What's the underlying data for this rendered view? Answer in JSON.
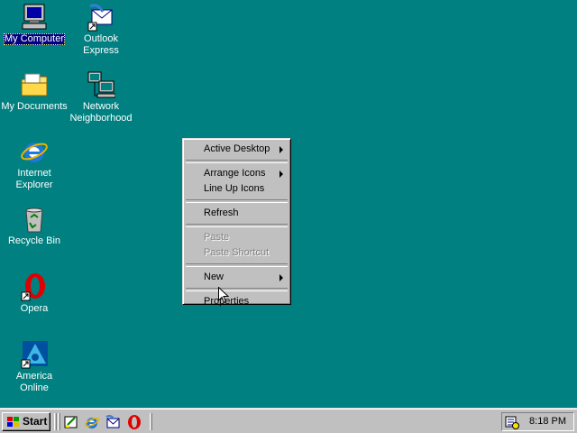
{
  "desktop": {
    "icons": [
      {
        "label": "My Computer"
      },
      {
        "label": "Outlook Express"
      },
      {
        "label": "My Documents"
      },
      {
        "label": "Network Neighborhood"
      },
      {
        "label": "Internet Explorer"
      },
      {
        "label": "Recycle Bin"
      },
      {
        "label": "Opera"
      },
      {
        "label": "America Online"
      }
    ]
  },
  "context_menu": {
    "items": [
      {
        "label": "Active Desktop",
        "submenu": true,
        "enabled": true
      },
      {
        "label": "Arrange Icons",
        "submenu": true,
        "enabled": true
      },
      {
        "label": "Line Up Icons",
        "submenu": false,
        "enabled": true
      },
      {
        "label": "Refresh",
        "submenu": false,
        "enabled": true
      },
      {
        "label": "Paste",
        "submenu": false,
        "enabled": false
      },
      {
        "label": "Paste Shortcut",
        "submenu": false,
        "enabled": false
      },
      {
        "label": "New",
        "submenu": true,
        "enabled": true
      },
      {
        "label": "Properties",
        "submenu": false,
        "enabled": true
      }
    ]
  },
  "taskbar": {
    "start_label": "Start",
    "quick_launch": [
      "show-desktop-icon",
      "internet-explorer-icon",
      "outlook-express-icon",
      "opera-icon"
    ],
    "clock": "8:18 PM"
  },
  "colors": {
    "desktop": "#008080",
    "face": "#c0c0c0",
    "selection": "#000080"
  }
}
